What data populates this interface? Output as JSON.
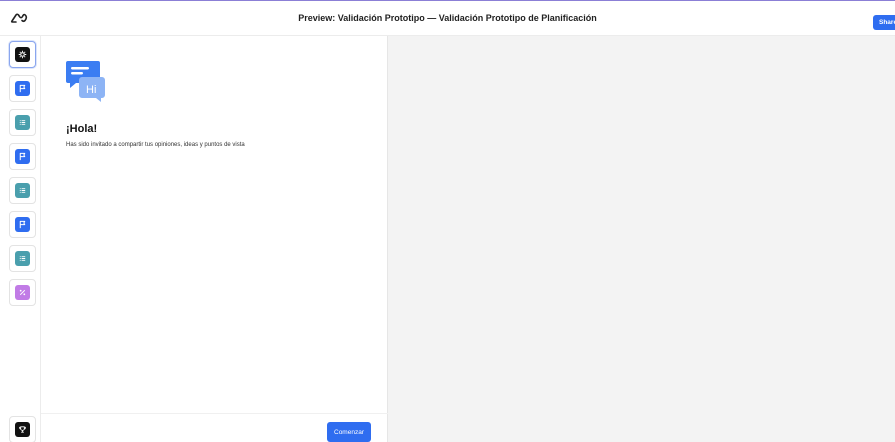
{
  "header": {
    "title": "Preview: Validación Prototipo — Validación Prototipo de Planificación",
    "share_label": "Share",
    "logo_icon": "infinity-logo-icon"
  },
  "rail": {
    "items": [
      {
        "icon": "settings-icon",
        "color": "#111111",
        "active": true
      },
      {
        "icon": "flag-icon",
        "color": "#2f6df0"
      },
      {
        "icon": "list-icon",
        "color": "#4a9fad"
      },
      {
        "icon": "flag-icon",
        "color": "#2f6df0"
      },
      {
        "icon": "list-icon",
        "color": "#4a9fad"
      },
      {
        "icon": "flag-icon",
        "color": "#2f6df0"
      },
      {
        "icon": "list-icon",
        "color": "#4a9fad"
      },
      {
        "icon": "percent-icon",
        "color": "#c17be6"
      }
    ],
    "bottom_icon": "trophy-icon"
  },
  "welcome": {
    "badge_text": "Hi",
    "greeting": "¡Hola!",
    "message": "Has sido invitado a compartir tus opiniones, ideas y puntos de vista",
    "start_label": "Comenzar"
  }
}
